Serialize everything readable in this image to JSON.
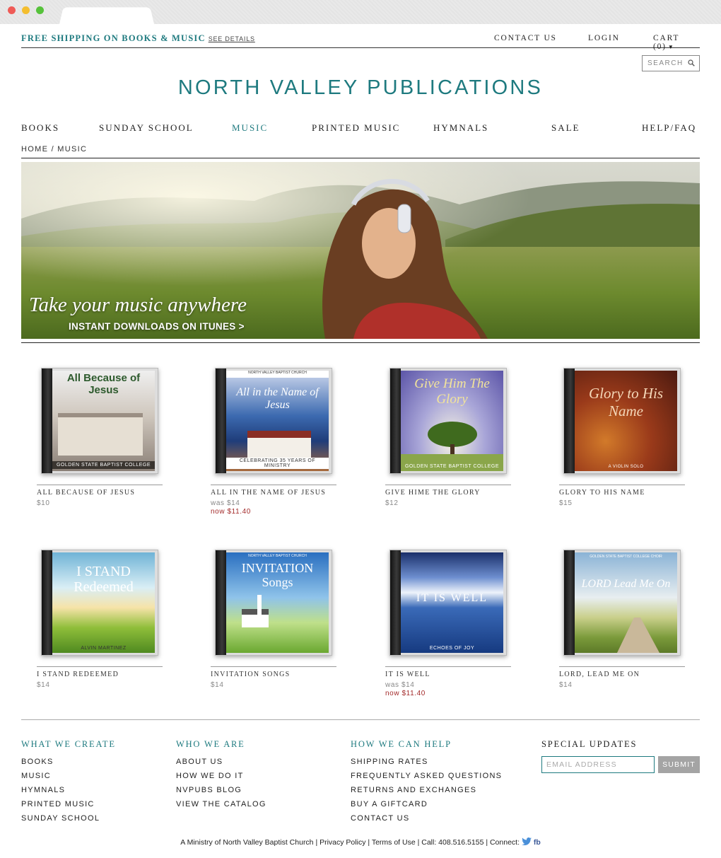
{
  "header": {
    "promo": "FREE SHIPPING ON BOOKS & MUSIC",
    "promo_link": "SEE DETAILS",
    "contact": "CONTACT US",
    "login": "LOGIN",
    "cart": "CART (0)",
    "search_placeholder": "SEARCH",
    "logo": "NORTH VALLEY PUBLICATIONS"
  },
  "nav": [
    "BOOKS",
    "SUNDAY SCHOOL",
    "MUSIC",
    "PRINTED MUSIC",
    "HYMNALS",
    "SALE",
    "HELP/FAQ"
  ],
  "breadcrumb": {
    "home": "HOME",
    "current": "MUSIC"
  },
  "hero": {
    "title": "Take your music anywhere",
    "subtitle": "INSTANT DOWNLOADS ON ITUNES >"
  },
  "products": [
    {
      "name": "ALL BECAUSE OF JESUS",
      "price": "$10",
      "art_title": "All Because of Jesus",
      "art_foot": "GOLDEN STATE BAPTIST COLLEGE"
    },
    {
      "name": "ALL IN THE NAME OF JESUS",
      "price": "was $14",
      "now": "now $11.40",
      "art_title": "All in the Name of Jesus",
      "art_foot": "CELEBRATING 35 YEARS OF MINISTRY",
      "art_top": "NORTH VALLEY BAPTIST CHURCH"
    },
    {
      "name": "GIVE HIME THE GLORY",
      "price": "$12",
      "art_title": "Give Him The Glory",
      "art_foot": "GOLDEN STATE BAPTIST COLLEGE"
    },
    {
      "name": "GLORY TO HIS NAME",
      "price": "$15",
      "art_title": "Glory to His Name",
      "art_foot": "A VIOLIN SOLO"
    },
    {
      "name": "I STAND REDEEMED",
      "price": "$14",
      "art_title": "I STAND Redeemed",
      "art_foot": "ALVIN MARTINEZ"
    },
    {
      "name": "INVITATION SONGS",
      "price": "$14",
      "art_title": "INVITATION Songs",
      "art_foot": "",
      "art_top": "NORTH VALLEY BAPTIST CHURCH"
    },
    {
      "name": "IT IS WELL",
      "price": "was $14",
      "now": "now $11.40",
      "art_title": "IT IS WELL",
      "art_foot": "ECHOES OF JOY"
    },
    {
      "name": "LORD, LEAD ME ON",
      "price": "$14",
      "art_title": "LORD Lead Me On",
      "art_foot": "",
      "art_top": "GOLDEN STATE BAPTIST COLLEGE CHOIR"
    }
  ],
  "footer": {
    "col1": {
      "title": "WHAT WE CREATE",
      "links": [
        "BOOKS",
        "MUSIC",
        "HYMNALS",
        "PRINTED MUSIC",
        "SUNDAY SCHOOL"
      ]
    },
    "col2": {
      "title": "WHO WE ARE",
      "links": [
        "ABOUT US",
        "HOW WE DO IT",
        "NVPUBS BLOG",
        "VIEW THE CATALOG"
      ]
    },
    "col3": {
      "title": "HOW WE CAN HELP",
      "links": [
        "SHIPPING RATES",
        "FREQUENTLY ASKED QUESTIONS",
        "RETURNS AND EXCHANGES",
        "BUY A GIFTCARD",
        "CONTACT US"
      ]
    },
    "col4": {
      "title": "SPECIAL UPDATES",
      "email_placeholder": "EMAIL ADDRESS",
      "submit": "SUBMIT"
    },
    "bottom": {
      "ministry": "A Ministry of North Valley Baptist Church",
      "privacy": "Privacy Policy",
      "terms": "Terms of Use",
      "call": "Call: 408.516.5155",
      "connect": "Connect:",
      "fb": "fb"
    }
  },
  "colors": {
    "accent": "#1e7a7f",
    "sale": "#a32a2a"
  }
}
